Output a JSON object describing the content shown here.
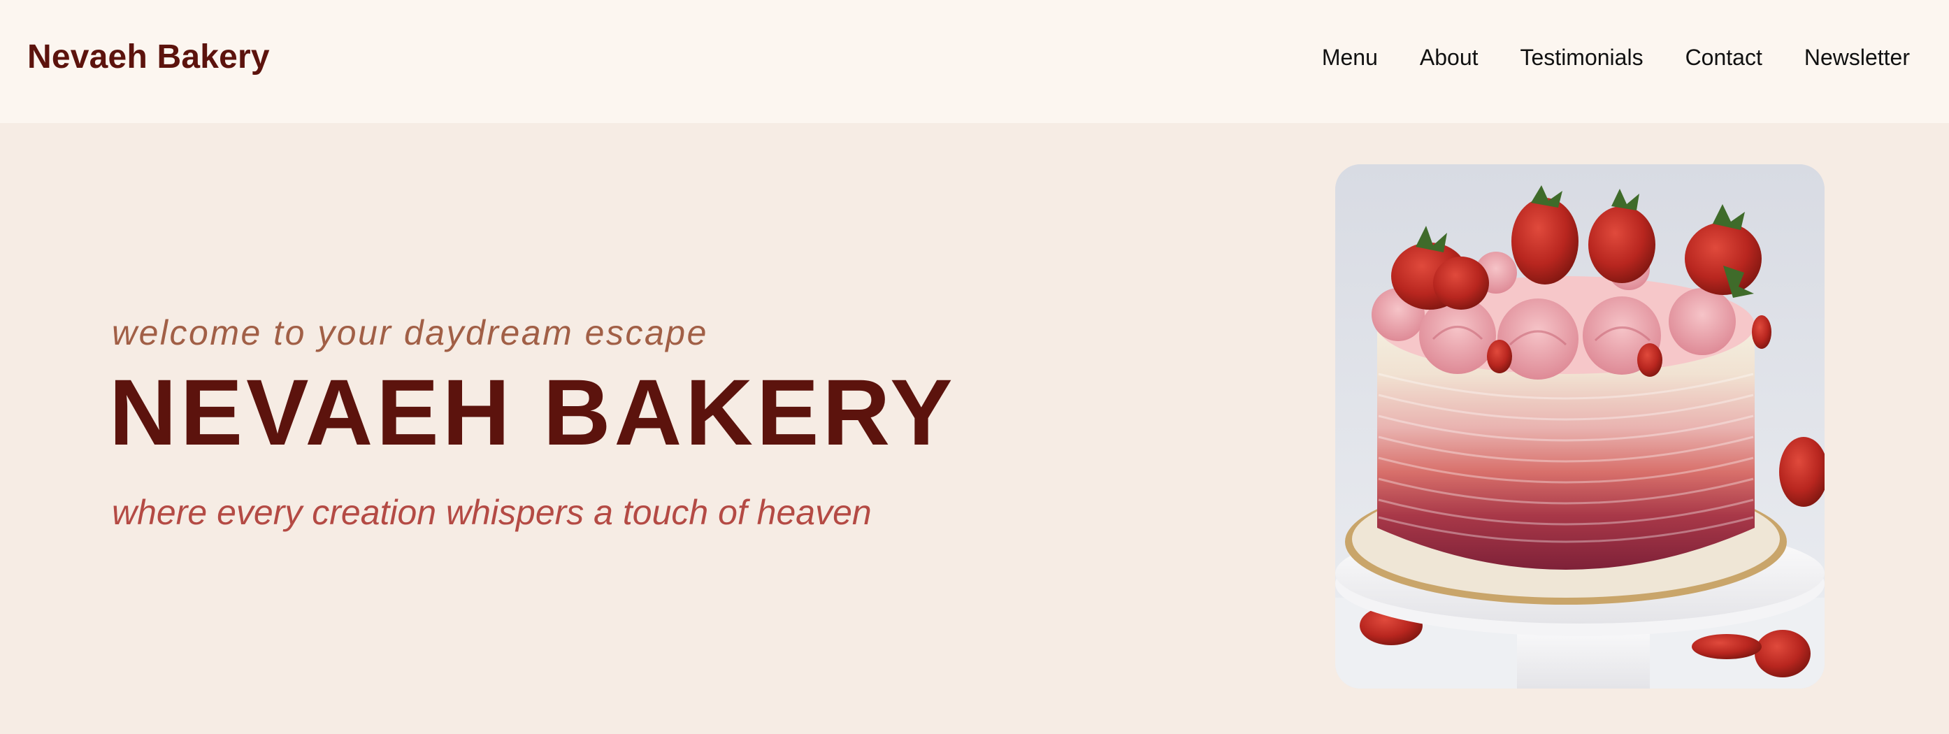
{
  "header": {
    "brand": "Nevaeh Bakery",
    "nav": [
      "Menu",
      "About",
      "Testimonials",
      "Contact",
      "Newsletter"
    ]
  },
  "hero": {
    "tagline": "welcome to your daydream escape",
    "title": "NEVAEH BAKERY",
    "subtitle": "where every creation whispers a touch of heaven"
  },
  "colors": {
    "header_bg": "#fcf6f0",
    "page_bg": "#f6ece4",
    "brand": "#5c130d",
    "tagline": "#a15f46",
    "subtitle": "#b44a44"
  },
  "image": {
    "icon": "strawberry-cake-image"
  }
}
